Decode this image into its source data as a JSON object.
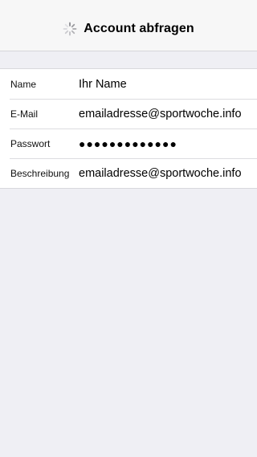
{
  "nav": {
    "title": "Account abfragen",
    "spinner_icon": "activity-spinner-icon"
  },
  "form": {
    "rows": [
      {
        "label": "Name",
        "value": "Ihr Name"
      },
      {
        "label": "E-Mail",
        "value": "emailadresse@sportwoche.info"
      },
      {
        "label": "Passwort",
        "value": "●●●●●●●●●●●●●"
      },
      {
        "label": "Beschreibung",
        "value": "emailadresse@sportwoche.info"
      }
    ]
  }
}
